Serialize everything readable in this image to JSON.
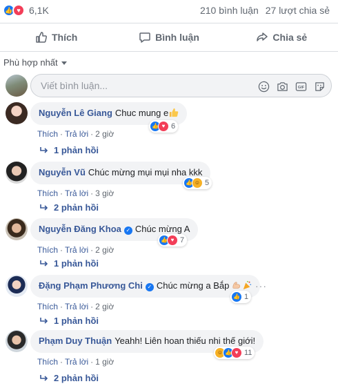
{
  "stats": {
    "reaction_count": "6,1K",
    "comments_count": "210 bình luận",
    "shares_count": "27 lượt chia sẻ"
  },
  "actions": {
    "like_label": "Thích",
    "comment_label": "Bình luận",
    "share_label": "Chia sẻ"
  },
  "sort": {
    "label": "Phù hợp nhất"
  },
  "composer": {
    "placeholder": "Viết bình luận..."
  },
  "comments": [
    {
      "name": "Nguyễn Lê Giang",
      "verified": false,
      "text": "Chuc mung e",
      "emoji": "thumbs-up",
      "reactions": [
        "like",
        "love"
      ],
      "reaction_count": "6",
      "like_label": "Thích",
      "reply_label": "Trả lời",
      "time": "2 giờ",
      "replies": "1 phản hồi"
    },
    {
      "name": "Nguyễn Vũ",
      "verified": false,
      "text": "Chúc mừng mụi mụi nha kkk",
      "emoji": "",
      "reactions": [
        "like",
        "haha"
      ],
      "reaction_count": "5",
      "like_label": "Thích",
      "reply_label": "Trả lời",
      "time": "3 giờ",
      "replies": "2 phản hồi"
    },
    {
      "name": "Nguyễn Đăng Khoa",
      "verified": true,
      "text": "Chúc mừng A",
      "emoji": "",
      "reactions": [
        "like",
        "love"
      ],
      "reaction_count": "7",
      "like_label": "Thích",
      "reply_label": "Trả lời",
      "time": "2 giờ",
      "replies": "1 phản hồi"
    },
    {
      "name": "Đặng Phạm Phương Chi",
      "verified": true,
      "text": "Chúc mừng a Bắp",
      "emoji": "muscle-party",
      "reactions": [
        "like"
      ],
      "reaction_count": "1",
      "like_label": "Thích",
      "reply_label": "Trả lời",
      "time": "2 giờ",
      "replies": "1 phản hồi"
    },
    {
      "name": "Phạm Duy Thuận",
      "verified": false,
      "text": "Yeahh! Liên hoan thiếu nhi thế giới!",
      "emoji": "",
      "reactions": [
        "haha",
        "like",
        "love"
      ],
      "reaction_count": "11",
      "like_label": "Thích",
      "reply_label": "Trả lời",
      "time": "1 giờ",
      "replies": "2 phản hồi"
    }
  ],
  "colors": {
    "link": "#385898",
    "like": "#1877f2",
    "love": "#f33e58",
    "muted": "#606770"
  }
}
